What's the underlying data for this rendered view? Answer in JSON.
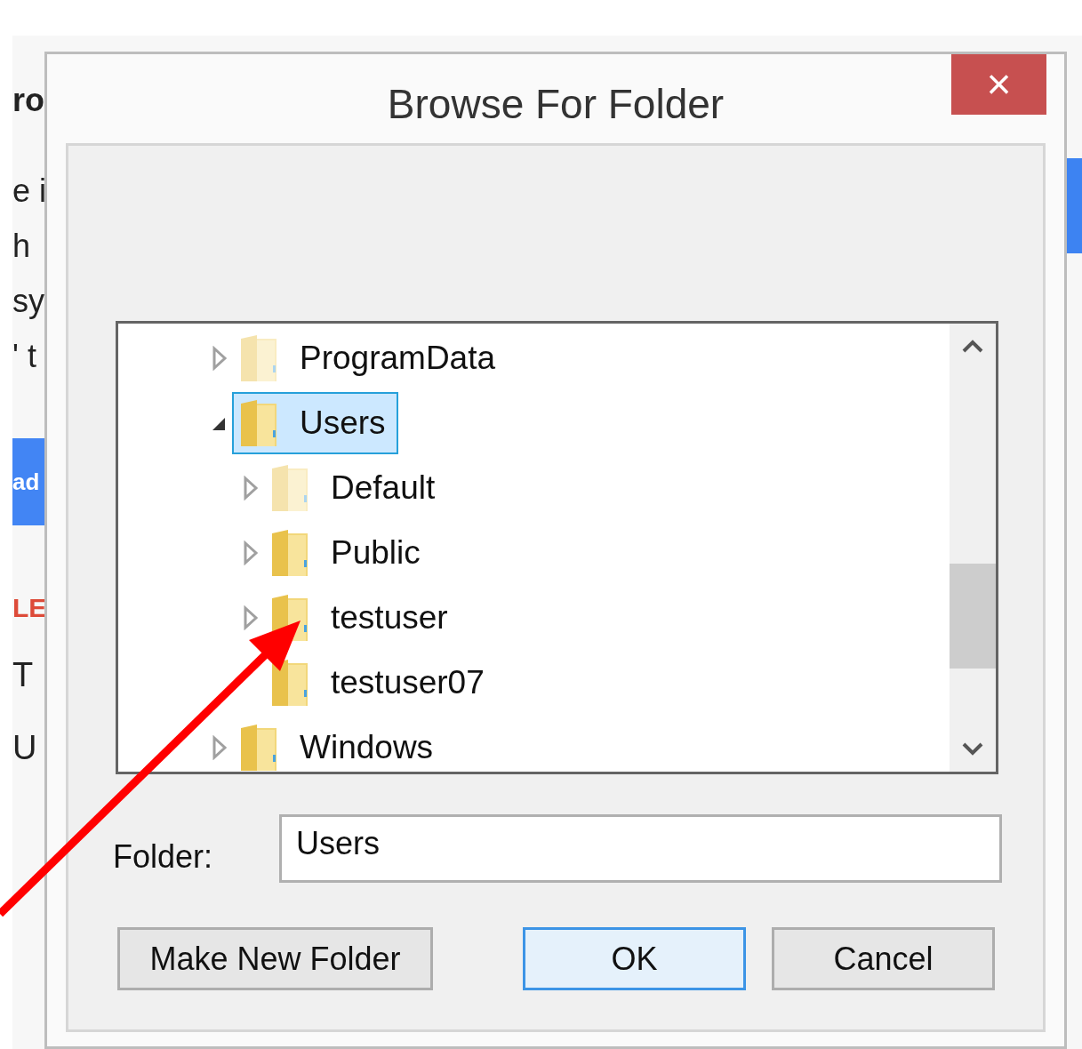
{
  "background_page": {
    "fragments": [
      {
        "kind": "heading",
        "text": "ro"
      },
      {
        "kind": "line",
        "text": "e i"
      },
      {
        "kind": "line",
        "text": "h"
      },
      {
        "kind": "line",
        "text": "sy"
      },
      {
        "kind": "line",
        "text": "' t"
      },
      {
        "kind": "button",
        "text": "ad"
      },
      {
        "kind": "alert",
        "text": "LE"
      },
      {
        "kind": "cell",
        "text": "T"
      },
      {
        "kind": "cell",
        "text": "U"
      }
    ]
  },
  "dialog": {
    "title": "Browse For Folder",
    "close": "×",
    "tree": [
      {
        "label": "ProgramData",
        "expandable": true,
        "selected": false,
        "hidden": true
      },
      {
        "label": "Users",
        "expandable": true,
        "expanded": true,
        "selected": true,
        "hidden": false,
        "children": [
          {
            "label": "Default",
            "expandable": true,
            "selected": false,
            "hidden": true
          },
          {
            "label": "Public",
            "expandable": true,
            "selected": false,
            "hidden": false
          },
          {
            "label": "testuser",
            "expandable": true,
            "selected": false,
            "hidden": false
          },
          {
            "label": "testuser07",
            "expandable": false,
            "selected": false,
            "hidden": false
          }
        ]
      },
      {
        "label": "Windows",
        "expandable": true,
        "selected": false,
        "hidden": false
      }
    ],
    "folder_label": "Folder:",
    "folder_value": "Users",
    "buttons": [
      {
        "label": "Make New Folder",
        "default": false
      },
      {
        "label": "OK",
        "default": true
      },
      {
        "label": "Cancel",
        "default": false
      }
    ]
  }
}
